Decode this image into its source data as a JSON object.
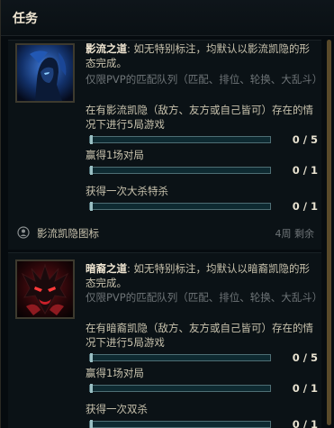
{
  "header": {
    "title": "任务"
  },
  "missions": [
    {
      "title": "影流之道",
      "colon": ": ",
      "description": "如无特别标注，均默认以影流凯隐的形态完成。",
      "restriction": "仅限PVP的匹配队列（匹配、排位、轮换、大乱斗）",
      "objectives": [
        {
          "text": "在有影流凯隐（敌方、友方或自己皆可）存在的情况下进行5局游戏",
          "count": "0 / 5",
          "progress": 0
        },
        {
          "text": "赢得1场对局",
          "count": "0 / 1",
          "progress": 0
        },
        {
          "text": "获得一次大杀特杀",
          "count": "0 / 1",
          "progress": 0
        }
      ],
      "reward": {
        "label": "影流凯隐图标",
        "icon": "reward-icon"
      },
      "time_left": "4周 剩余",
      "icon": "shadow-assassin-icon",
      "accent": "#2c5fa8"
    },
    {
      "title": "暗裔之道",
      "colon": ": ",
      "description": "如无特别标注，均默认以暗裔凯隐的形态完成。",
      "restriction": "仅限PVP的匹配队列（匹配、排位、轮换、大乱斗）",
      "objectives": [
        {
          "text": "在有暗裔凯隐（敌方、友方或自己皆可）存在的情况下进行5局游戏",
          "count": "0 / 5",
          "progress": 0
        },
        {
          "text": "赢得1场对局",
          "count": "0 / 1",
          "progress": 0
        },
        {
          "text": "获得一次双杀",
          "count": "0 / 1",
          "progress": 0
        }
      ],
      "icon": "darkin-rhaast-icon",
      "accent": "#b5222a"
    }
  ]
}
